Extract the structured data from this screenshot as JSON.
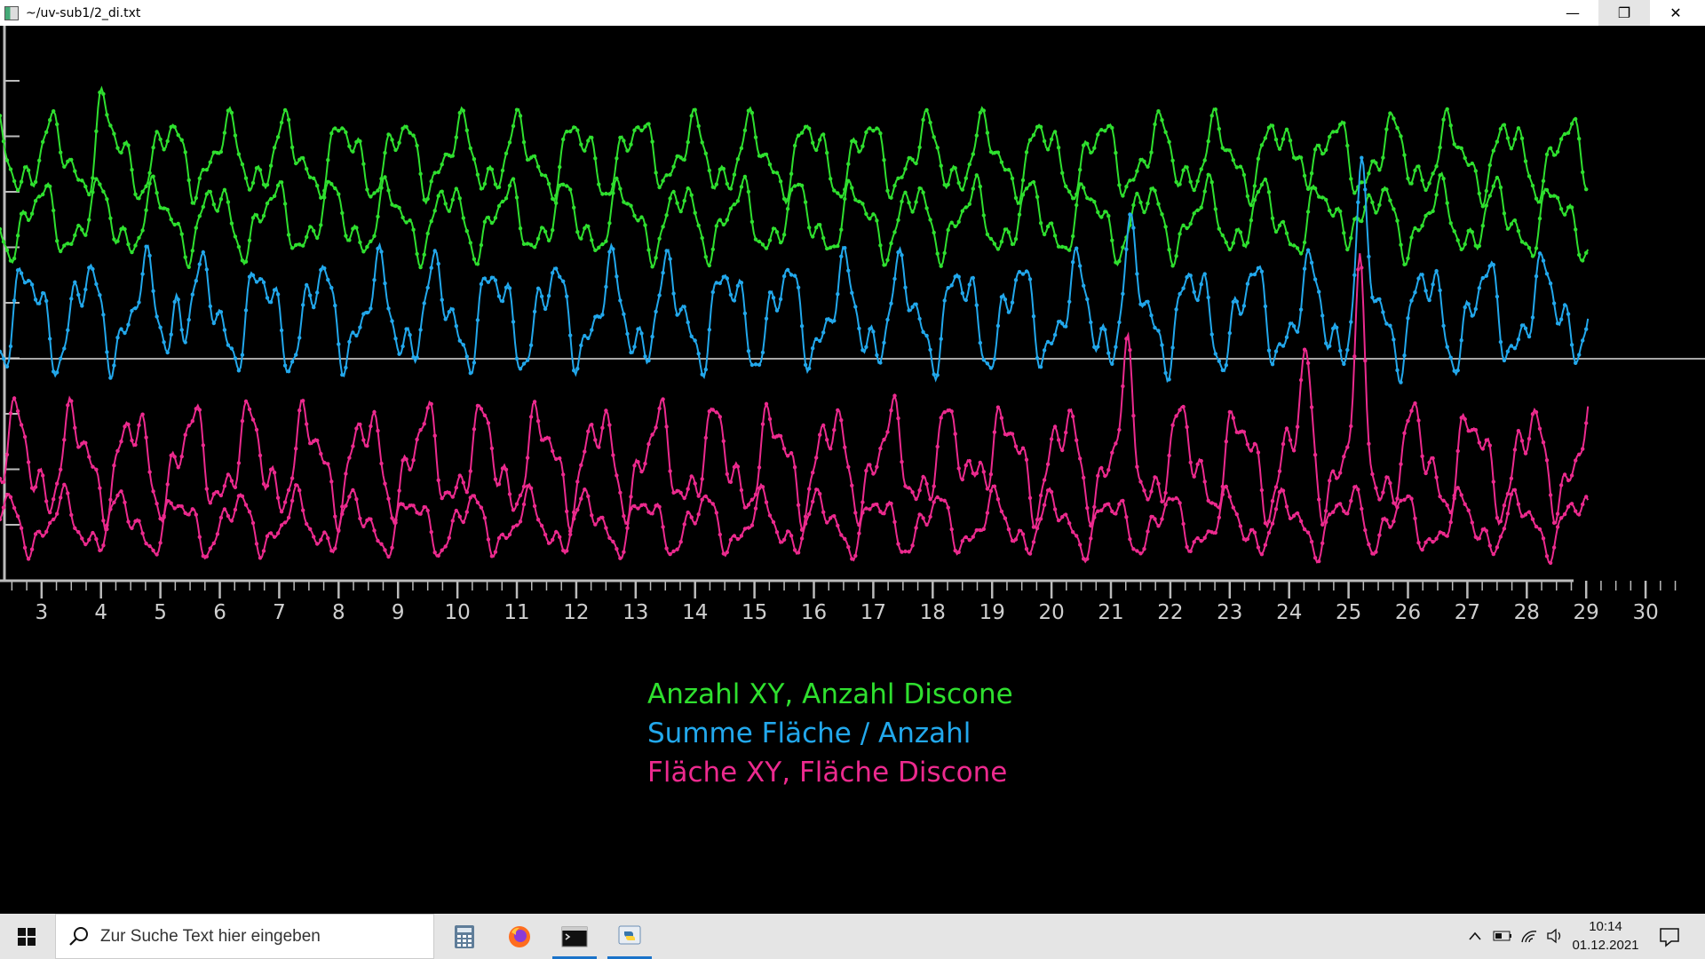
{
  "window": {
    "title": "~/uv-sub1/2_di.txt",
    "minimize_glyph": "—",
    "maximize_glyph": "❐",
    "close_glyph": "✕"
  },
  "chart_data": {
    "type": "line",
    "x_tick_labels": [
      "3",
      "4",
      "5",
      "6",
      "7",
      "8",
      "9",
      "10",
      "11",
      "12",
      "13",
      "14",
      "15",
      "16",
      "17",
      "18",
      "19",
      "20",
      "21",
      "22",
      "23",
      "24",
      "25",
      "26",
      "27",
      "28",
      "29",
      "30"
    ],
    "xlim": [
      2.3,
      31.0
    ],
    "reference_line": true,
    "grid": false,
    "legend": [
      {
        "text": "Anzahl XY, Anzahl Discone",
        "color": "#2fe02f"
      },
      {
        "text": "Summe Fläche / Anzahl",
        "color": "#22a8ec"
      },
      {
        "text": "Fläche XY, Fläche Discone",
        "color": "#ec2a8e"
      }
    ],
    "legend_position": "bottom-center",
    "series": [
      {
        "color": "#2fe02f",
        "base": 0.8,
        "amp": 0.058,
        "peaks": [
          [
            4.0,
            0.07
          ],
          [
            13.3,
            0.05
          ],
          [
            24.2,
            0.06
          ]
        ]
      },
      {
        "color": "#2fe02f",
        "base": 0.68,
        "amp": 0.055,
        "peaks": [
          [
            25.1,
            0.06
          ]
        ]
      },
      {
        "color": "#22a8ec",
        "base": 0.5,
        "amp": 0.08,
        "peaks": [
          [
            5.3,
            0.07
          ],
          [
            21.3,
            0.08
          ],
          [
            25.2,
            0.2
          ],
          [
            28.6,
            0.05
          ]
        ]
      },
      {
        "color": "#ec2a8e",
        "base": 0.22,
        "amp": 0.08,
        "peaks": [
          [
            21.3,
            0.12
          ],
          [
            24.3,
            0.14
          ],
          [
            25.2,
            0.27
          ],
          [
            18.8,
            0.08
          ]
        ]
      },
      {
        "color": "#ec2a8e",
        "base": 0.1,
        "amp": 0.045,
        "peaks": [
          [
            25.2,
            0.05
          ]
        ]
      }
    ]
  },
  "taskbar": {
    "search_placeholder": "Zur Suche Text hier eingeben",
    "apps": [
      "calculator-icon",
      "firefox-icon",
      "terminal-icon",
      "python-icon"
    ],
    "clock_time": "10:14",
    "clock_date": "01.12.2021"
  }
}
